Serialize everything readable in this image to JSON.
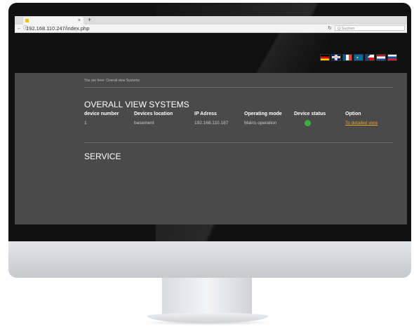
{
  "browser": {
    "tab_close": "×",
    "new_tab": "+",
    "nav_icons": "← ⓘ",
    "url": "192.168.110.247/index.php",
    "reload_icon": "↻",
    "search_placeholder": "Q Suchen"
  },
  "header": {
    "flags": [
      {
        "name": "german-flag-icon",
        "colors": [
          "#000000",
          "#dd0000",
          "#ffce00"
        ],
        "dir": "h"
      },
      {
        "name": "uk-flag-icon",
        "colors": [
          "#012169",
          "#ffffff",
          "#c8102e"
        ],
        "dir": "uk"
      },
      {
        "name": "french-flag-icon",
        "colors": [
          "#0055a4",
          "#ffffff",
          "#ef4135"
        ],
        "dir": "v"
      },
      {
        "name": "swedish-flag-icon",
        "colors": [
          "#006aa7",
          "#fecc00"
        ],
        "dir": "cross"
      },
      {
        "name": "czech-flag-icon",
        "colors": [
          "#ffffff",
          "#d7141a",
          "#11457e"
        ],
        "dir": "cz"
      },
      {
        "name": "dutch-flag-icon",
        "colors": [
          "#ae1c28",
          "#ffffff",
          "#21468b"
        ],
        "dir": "h"
      },
      {
        "name": "slovak-flag-icon",
        "colors": [
          "#ffffff",
          "#0b4ea2",
          "#ee1c25"
        ],
        "dir": "h"
      }
    ]
  },
  "main": {
    "breadcrumb": "You are here: Overall view Systems",
    "title": "OVERALL VIEW SYSTEMS",
    "table": {
      "headers": [
        "device number",
        "Devices location",
        "IP Adress",
        "Operating mode",
        "Device status",
        "Option"
      ],
      "row": {
        "device_number": "1",
        "location": "basement",
        "ip": "192.168.110.187",
        "mode": "Mains operation",
        "status_color": "#3fae3f",
        "option_link": "To detailed view"
      }
    },
    "service_title": "SERVICE"
  }
}
